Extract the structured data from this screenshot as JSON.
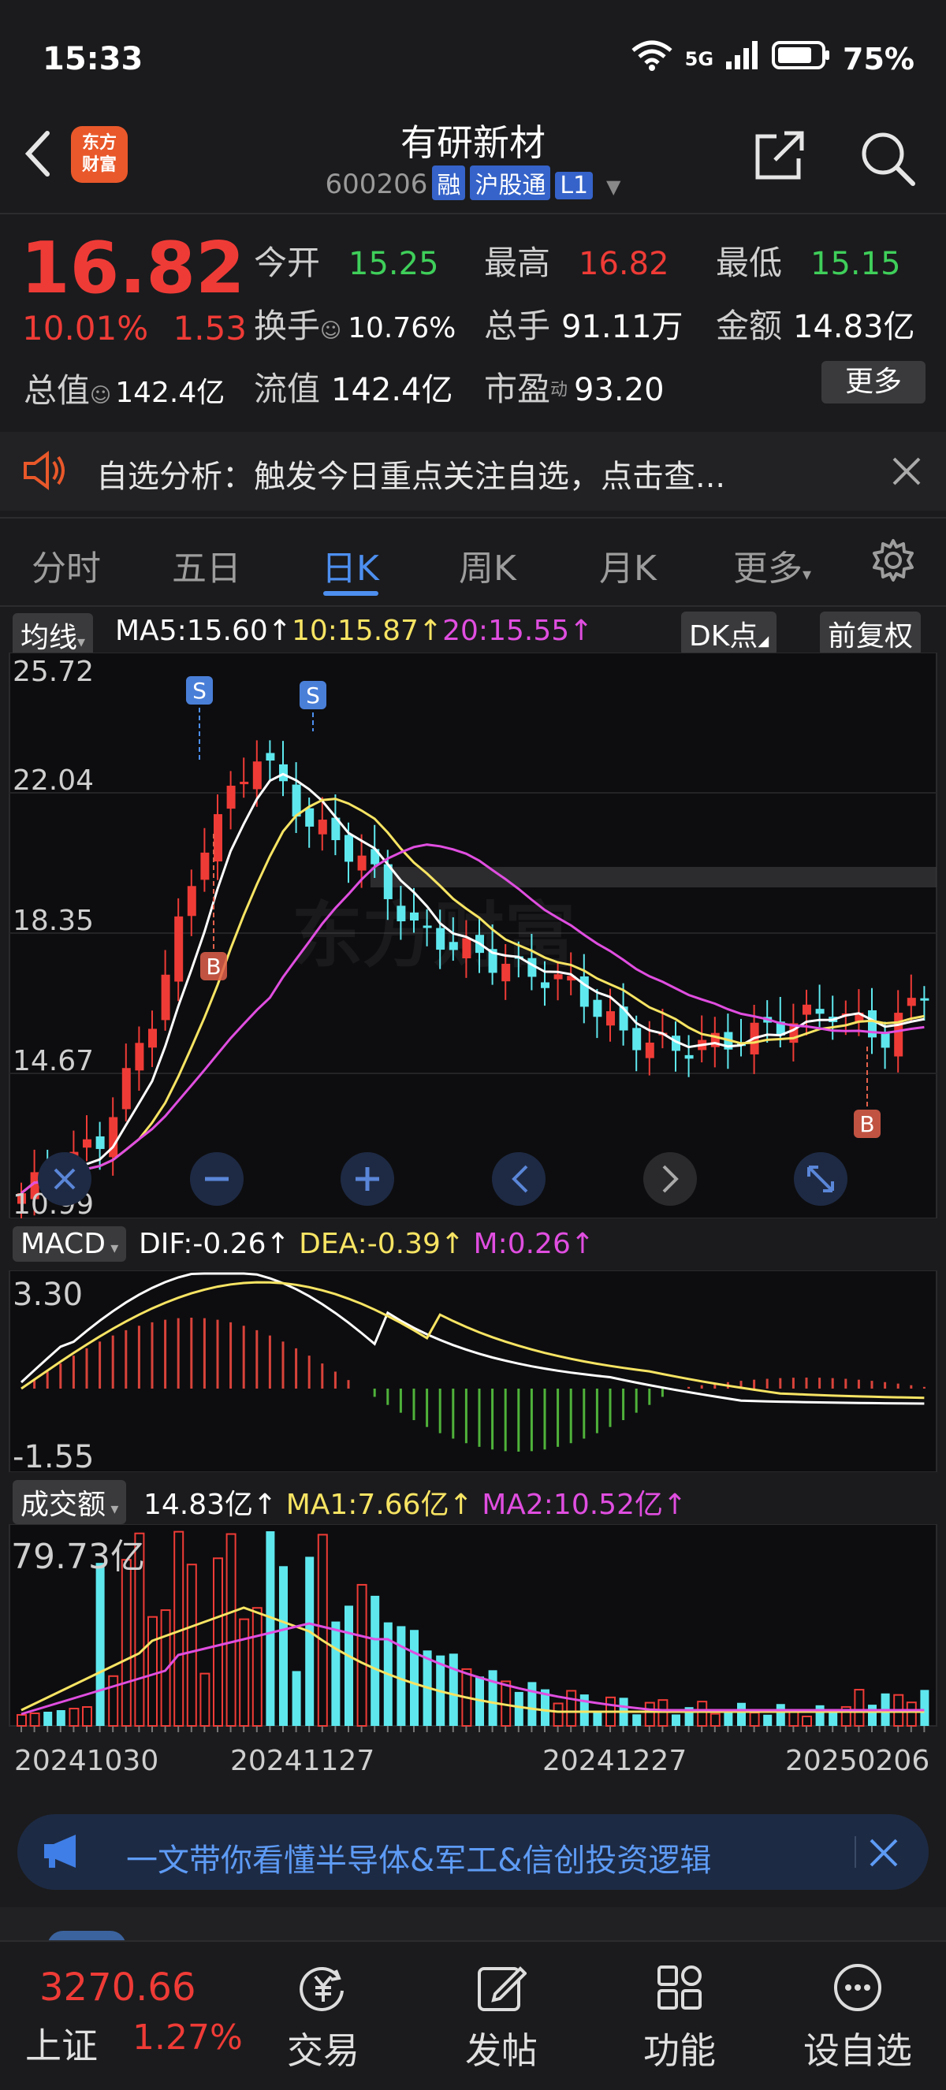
{
  "status": {
    "time": "15:33",
    "network": "5G",
    "battery": "75%"
  },
  "header": {
    "logo_line1": "东方",
    "logo_line2": "财富",
    "title": "有研新材",
    "code": "600206",
    "tags": [
      "融",
      "沪股通",
      "L1"
    ]
  },
  "quote": {
    "price": "16.82",
    "change_pct": "10.01%",
    "change_amt": "1.53",
    "open_label": "今开",
    "open": "15.25",
    "high_label": "最高",
    "high": "16.82",
    "low_label": "最低",
    "low": "15.15",
    "turnover_label": "换手",
    "turnover": "10.76%",
    "volume_label": "总手",
    "volume": "91.11万",
    "amount_label": "金额",
    "amount": "14.83亿",
    "mcap_label": "总值",
    "mcap": "142.4亿",
    "float_label": "流值",
    "float": "142.4亿",
    "pe_label": "市盈",
    "pe_sup": "动",
    "pe": "93.20",
    "more": "更多"
  },
  "banner": {
    "text": "自选分析：触发今日重点关注自选，点击查..."
  },
  "tabs": {
    "items": [
      "分时",
      "五日",
      "日K",
      "周K",
      "月K",
      "更多"
    ],
    "active": "日K"
  },
  "kline": {
    "indicator": "均线",
    "ma5": "MA5:15.60↑",
    "ma10": "10:15.87↑",
    "ma20": "20:15.55↑",
    "dk_button": "DK点",
    "adjust_button": "前复权",
    "y_labels": [
      "25.72",
      "22.04",
      "18.35",
      "14.67",
      "10.99"
    ],
    "signal_s": "S",
    "signal_b": "B",
    "watermark": "东方财富"
  },
  "macd": {
    "label": "MACD",
    "dif": "DIF:-0.26↑",
    "dea": "DEA:-0.39↑",
    "m": "M:0.26↑",
    "y_top": "3.30",
    "y_bottom": "-1.55"
  },
  "volume": {
    "label": "成交额",
    "value": "14.83亿↑",
    "ma1": "MA1:7.66亿↑",
    "ma2": "MA2:10.52亿↑",
    "y_top": "79.73亿",
    "dates": [
      "20241030",
      "20241127",
      "20241227",
      "20250206"
    ]
  },
  "ad": {
    "text": "一文带你看懂半导体&军工&信创投资逻辑"
  },
  "bottom_nav": {
    "index_value": "3270.66",
    "index_name": "上证",
    "index_pct": "1.27%",
    "items": [
      "交易",
      "发帖",
      "功能",
      "设自选"
    ]
  },
  "colors": {
    "up": "#ef3b36",
    "down": "#5ee8ee",
    "accent": "#4d8ff0",
    "ma5": "#ffffff",
    "ma10": "#f7e463",
    "ma20": "#e04ee0"
  }
}
